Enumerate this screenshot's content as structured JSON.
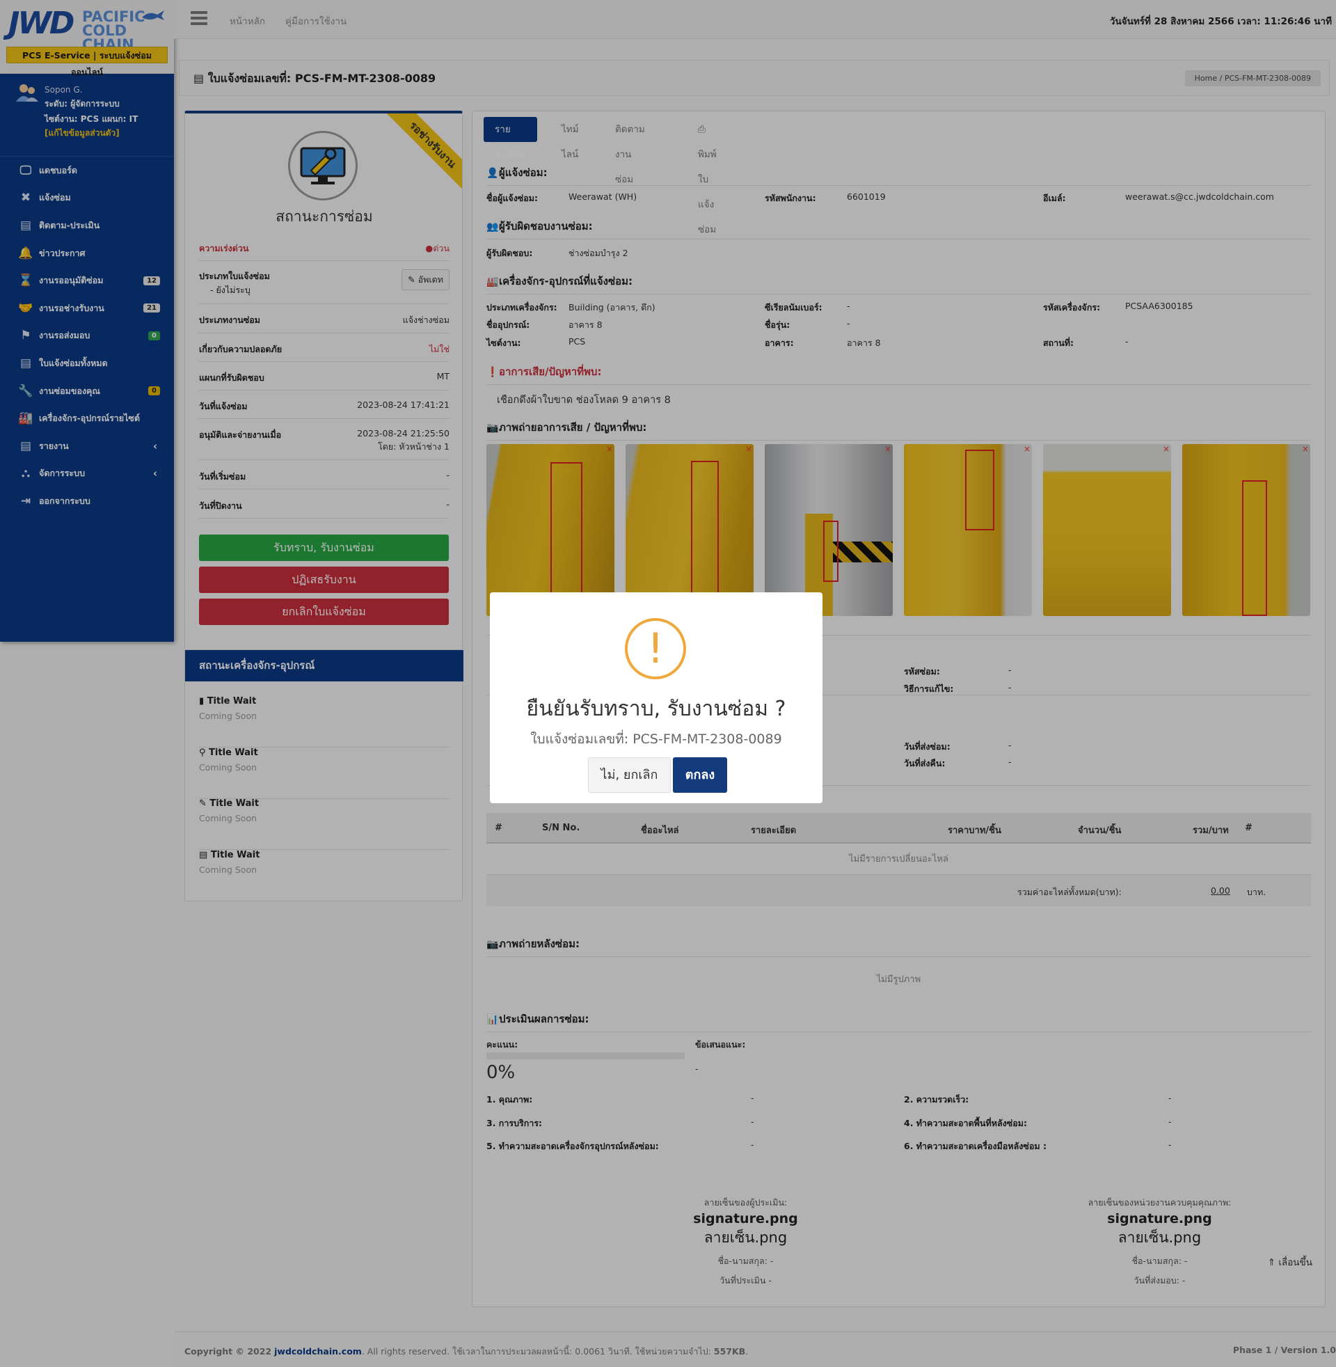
{
  "brand": {
    "logo_main": "JWD",
    "logo_sub1": "PACIFIC",
    "logo_sub2": "COLD CHAIN",
    "tagline": "PCS E-Service | ระบบแจ้งซ่อมออนไลน์"
  },
  "user": {
    "name": "Sopon G.",
    "level": "ระดับ: ผู้จัดการระบบ",
    "site": "ไซต์งาน: PCS แผนก: IT",
    "edit": "[แก้ไขข้อมูลส่วนตัว]"
  },
  "menu": [
    {
      "label": "แดชบอร์ด",
      "icon": "monitor-icon"
    },
    {
      "label": "แจ้งซ่อม",
      "icon": "tools-icon"
    },
    {
      "label": "ติดตาม-ประเมิน",
      "icon": "file-icon"
    },
    {
      "label": "ข่าวประกาศ",
      "icon": "bell-icon"
    },
    {
      "label": "งานรออนุมัติซ่อม",
      "icon": "hourglass-icon",
      "badge": "12"
    },
    {
      "label": "งานรอช่างรับงาน",
      "icon": "handshake-icon",
      "badge": "21"
    },
    {
      "label": "งานรอส่งมอบ",
      "icon": "flag-icon",
      "badge": "0"
    },
    {
      "label": "ใบแจ้งซ่อมทั้งหมด",
      "icon": "file-icon"
    },
    {
      "label": "งานซ่อมของคุณ",
      "icon": "wrench-icon",
      "badge": "0"
    },
    {
      "label": "เครื่องจักร-อุปกรณ์รายไซต์",
      "icon": "factory-icon"
    },
    {
      "label": "รายงาน",
      "icon": "file-icon"
    },
    {
      "label": "จัดการระบบ",
      "icon": "sitemap-icon"
    },
    {
      "label": "ออกจากระบบ",
      "icon": "signout-icon"
    }
  ],
  "topbar": {
    "nav_home": "หน้าหลัก",
    "nav_manual": "คู่มือการใช้งาน",
    "datetime": "วันจันทร์ที่ 28 สิงหาคม 2566 เวลา: 11:26:46 นาที"
  },
  "page": {
    "title": "ใบแจ้งซ่อมเลขที่: PCS-FM-MT-2308-0089",
    "crumb_home": "Home",
    "crumb_sep": "/",
    "crumb_current": "PCS-FM-MT-2308-0089"
  },
  "status": {
    "ribbon": "รอช่างรับงาน",
    "title": "สถานะการซ่อม",
    "urgency_label": "ความเร่งด่วน",
    "urgency_value": "ด่วน",
    "type_label": "ประเภทใบแจ้งซ่อม",
    "type_value": "- ยังไม่ระบุ",
    "update_btn": "อัพเดท",
    "worktype_label": "ประเภทงานซ่อม",
    "worktype_value": "แจ้งช่างซ่อม",
    "safety_label": "เกี่ยวกับความปลอดภัย",
    "safety_value": "ไม่ใช่",
    "dept_label": "แผนกที่รับผิดชอบ",
    "dept_value": "MT",
    "report_date_label": "วันที่แจ้งซ่อม",
    "report_date_value": "2023-08-24 17:41:21",
    "approve_label": "อนุมัติและจ่ายงานเมื่อ",
    "approve_value": "2023-08-24 21:25:50",
    "approve_by": "โดย: หัวหน้าช่าง 1",
    "start_label": "วันที่เริ่มซ่อม",
    "start_value": "-",
    "close_label": "วันที่ปิดงาน",
    "close_value": "-",
    "btn_accept": "รับทราบ, รับงานซ่อม",
    "btn_reject": "ปฏิเสธรับงาน",
    "btn_cancel": "ยกเลิกใบแจ้งซ่อม"
  },
  "machine_status": {
    "title": "สถานะเครื่องจักร-อุปกรณ์",
    "items": [
      {
        "title": "Title Wait",
        "sub": "Coming Soon",
        "icon": "book-icon"
      },
      {
        "title": "Title Wait",
        "sub": "Coming Soon",
        "icon": "map-marker-icon"
      },
      {
        "title": "Title Wait",
        "sub": "Coming Soon",
        "icon": "pencil-icon"
      },
      {
        "title": "Title Wait",
        "sub": "Coming Soon",
        "icon": "file-icon"
      }
    ]
  },
  "tabs": [
    "รายละเอียด",
    "ไทม์ไลน์",
    "ติดตามงานซ่อม",
    "พิมพ์ใบแจ้งซ่อม"
  ],
  "reporter": {
    "heading": "ผู้แจ้งซ่อม:",
    "name_label": "ชื่อผู้แจ้งซ่อม:",
    "name": "Weerawat (WH)",
    "emp_label": "รหัสพนักงาน:",
    "emp": "6601019",
    "email_label": "อีเมล์:",
    "email": "weerawat.s@cc.jwdcoldchain.com"
  },
  "responsible": {
    "heading": "ผู้รับผิดชอบงานซ่อม:",
    "label": "ผู้รับผิดชอบ:",
    "value": "ช่างซ่อมบำรุง 2"
  },
  "equipment": {
    "heading": "เครื่องจักร-อุปกรณ์ที่แจ้งซ่อม:",
    "type_label": "ประเภทเครื่องจักร:",
    "type": "Building (อาคาร, ตึก)",
    "serial_label": "ซีเรียลนัมเบอร์:",
    "serial": "-",
    "code_label": "รหัสเครื่องจักร:",
    "code": "PCSAA6300185",
    "name_label": "ชื่ออุปกรณ์:",
    "name": "อาคาร 8",
    "model_label": "ชื่อรุ่น:",
    "model": "-",
    "site_label": "ไซต์งาน:",
    "site": "PCS",
    "building_label": "อาคาร:",
    "building": "อาคาร 8",
    "place_label": "สถานที่:",
    "place": "-"
  },
  "problem": {
    "heading": "อาการเสีย/ปัญหาที่พบ:",
    "text": "เชือกดึงผ้าใบขาด ช่องโหลด 9 อาคาร 8"
  },
  "photos": {
    "heading": "ภาพถ่ายอาการเสีย / ปัญหาที่พบ:",
    "delete_mark": "×"
  },
  "repair": {
    "code_label": "รหัสซ่อม:",
    "code": "-",
    "method_label": "วิธีการแก้ไข:",
    "method": "-",
    "send_label": "วันที่ส่งซ่อม:",
    "send": "-",
    "return_label": "วันที่ส่งคืน:",
    "return": "-"
  },
  "parts": {
    "headers": [
      "#",
      "S/N No.",
      "ชื่ออะไหล่",
      "รายละเอียด",
      "ราคาบาท/ชิ้น",
      "จำนวน/ชิ้น",
      "รวม/บาท",
      "#"
    ],
    "empty": "ไม่มีรายการเปลี่ยนอะไหล่",
    "total_label": "รวมค่าอะไหล่ทั้งหมด(บาท):",
    "total": "0.00",
    "unit": "บาท."
  },
  "after_photos": {
    "heading": "ภาพถ่ายหลังซ่อม:",
    "empty": "ไม่มีรูปภาพ"
  },
  "evaluation": {
    "heading": "ประเมินผลการซ่อม:",
    "score_label": "คะแนน:",
    "score": "0%",
    "progress": 0,
    "suggest_label": "ข้อเสนอแนะ:",
    "suggest": "-",
    "items": [
      {
        "label": "1. คุณภาพ:",
        "value": "-"
      },
      {
        "label": "2. ความรวดเร็ว:",
        "value": "-"
      },
      {
        "label": "3. การบริการ:",
        "value": "-"
      },
      {
        "label": "4. ทำความสะอาดพื้นที่หลังซ่อม:",
        "value": "-"
      },
      {
        "label": "5. ทำความสะอาดเครื่องจักรอุปกรณ์หลังซ่อม:",
        "value": "-"
      },
      {
        "label": "6. ทำความสะอาดเครื่องมือหลังซ่อม :",
        "value": "-"
      }
    ]
  },
  "signatures": {
    "left": {
      "label": "ลายเซ็นของผู้ประเมิน:",
      "img1": "signature.png",
      "img2": "ลายเซ็น.png",
      "name": "ชื่อ-นามสกุล: -",
      "date": "วันที่ประเมิน -"
    },
    "right": {
      "label": "ลายเซ็นของหน่วยงานควบคุมคุณภาพ:",
      "img1": "signature.png",
      "img2": "ลายเซ็น.png",
      "name": "ชื่อ-นามสกุล: -",
      "date": "วันที่ส่งมอบ: -"
    }
  },
  "scroll_top": "เลื่อนขึ้น",
  "modal": {
    "title": "ยืนยันรับทราบ, รับงานซ่อม ?",
    "subtitle": "ใบแจ้งซ่อมเลขที่: PCS-FM-MT-2308-0089",
    "btn_no": "ไม่, ยกเลิก",
    "btn_ok": "ตกลง",
    "icon": "exclamation-icon"
  },
  "footer": {
    "copy": "Copyright © 2022",
    "link": "jwdcoldchain.com",
    "rest": ". All rights reserved. ใช้เวลาในการประมวลผลหน้านี้: 0.0061 วินาที. ใช้หน่วยความจำไป:",
    "mem": "557KB",
    "version": "Phase 1 / Version 1.0"
  },
  "colors": {
    "navy": "#0b3a86",
    "yellow": "#f2c217",
    "green": "#28a745",
    "red": "#c9303e",
    "warning": "#f0a73b"
  }
}
